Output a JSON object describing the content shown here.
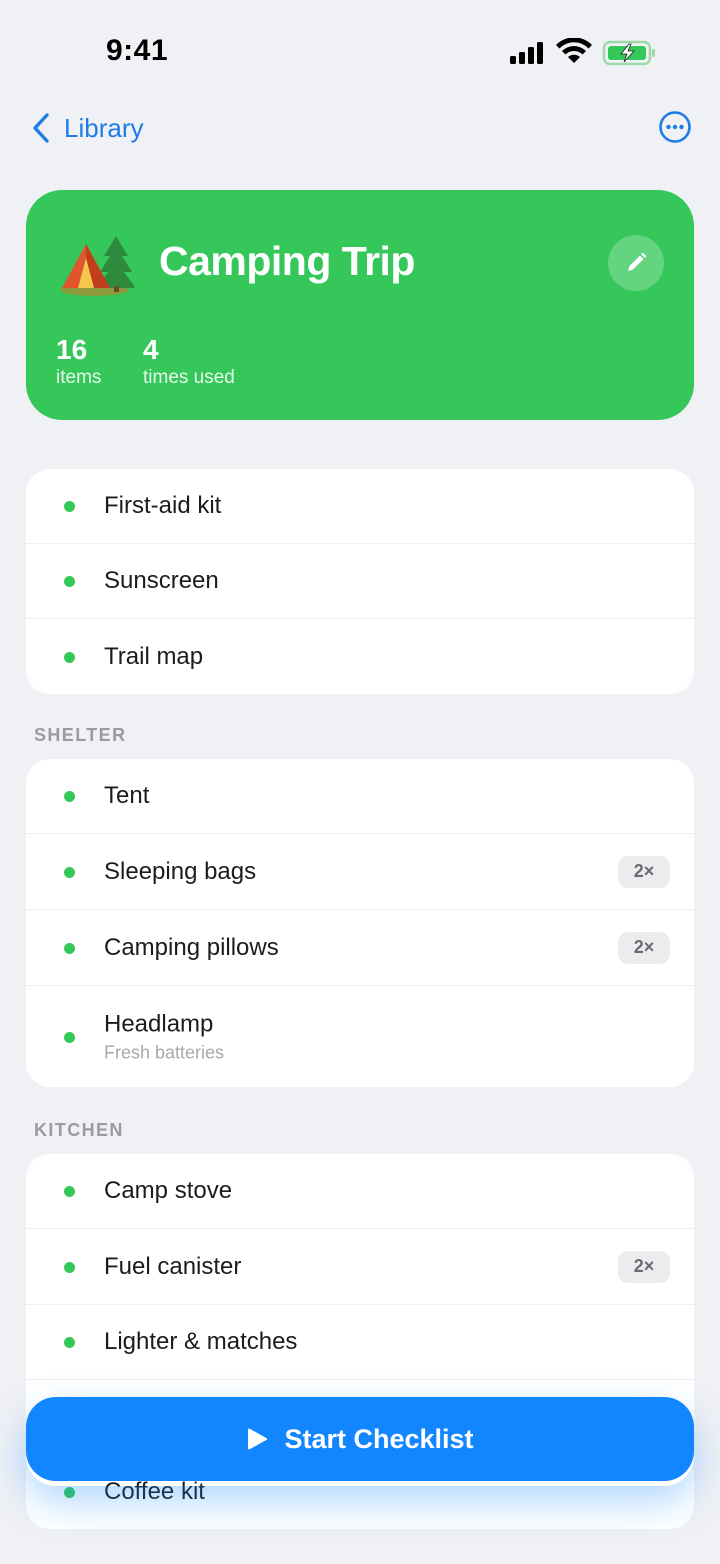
{
  "status_bar": {
    "time": "9:41"
  },
  "nav": {
    "back_label": "Library"
  },
  "hero": {
    "title": "Camping Trip",
    "stats": [
      {
        "value": "16",
        "label": "items"
      },
      {
        "value": "4",
        "label": "times used"
      }
    ]
  },
  "groups": [
    {
      "header": "",
      "items": [
        {
          "name": "First-aid kit"
        },
        {
          "name": "Sunscreen"
        },
        {
          "name": "Trail map"
        }
      ]
    },
    {
      "header": "SHELTER",
      "items": [
        {
          "name": "Tent"
        },
        {
          "name": "Sleeping bags",
          "qty": "2×"
        },
        {
          "name": "Camping pillows",
          "qty": "2×"
        },
        {
          "name": "Headlamp",
          "note": "Fresh batteries"
        }
      ]
    },
    {
      "header": "KITCHEN",
      "items": [
        {
          "name": "Camp stove"
        },
        {
          "name": "Fuel canister",
          "qty": "2×"
        },
        {
          "name": "Lighter & matches"
        },
        {
          "name": ""
        },
        {
          "name": "Coffee kit"
        }
      ]
    }
  ],
  "cta": {
    "label": "Start Checklist"
  },
  "colors": {
    "hero_green": "#35C75A",
    "accent_blue": "#1286FF",
    "link_blue": "#1E7CE8",
    "dot_green": "#34C759",
    "background": "#F0F1F5"
  }
}
